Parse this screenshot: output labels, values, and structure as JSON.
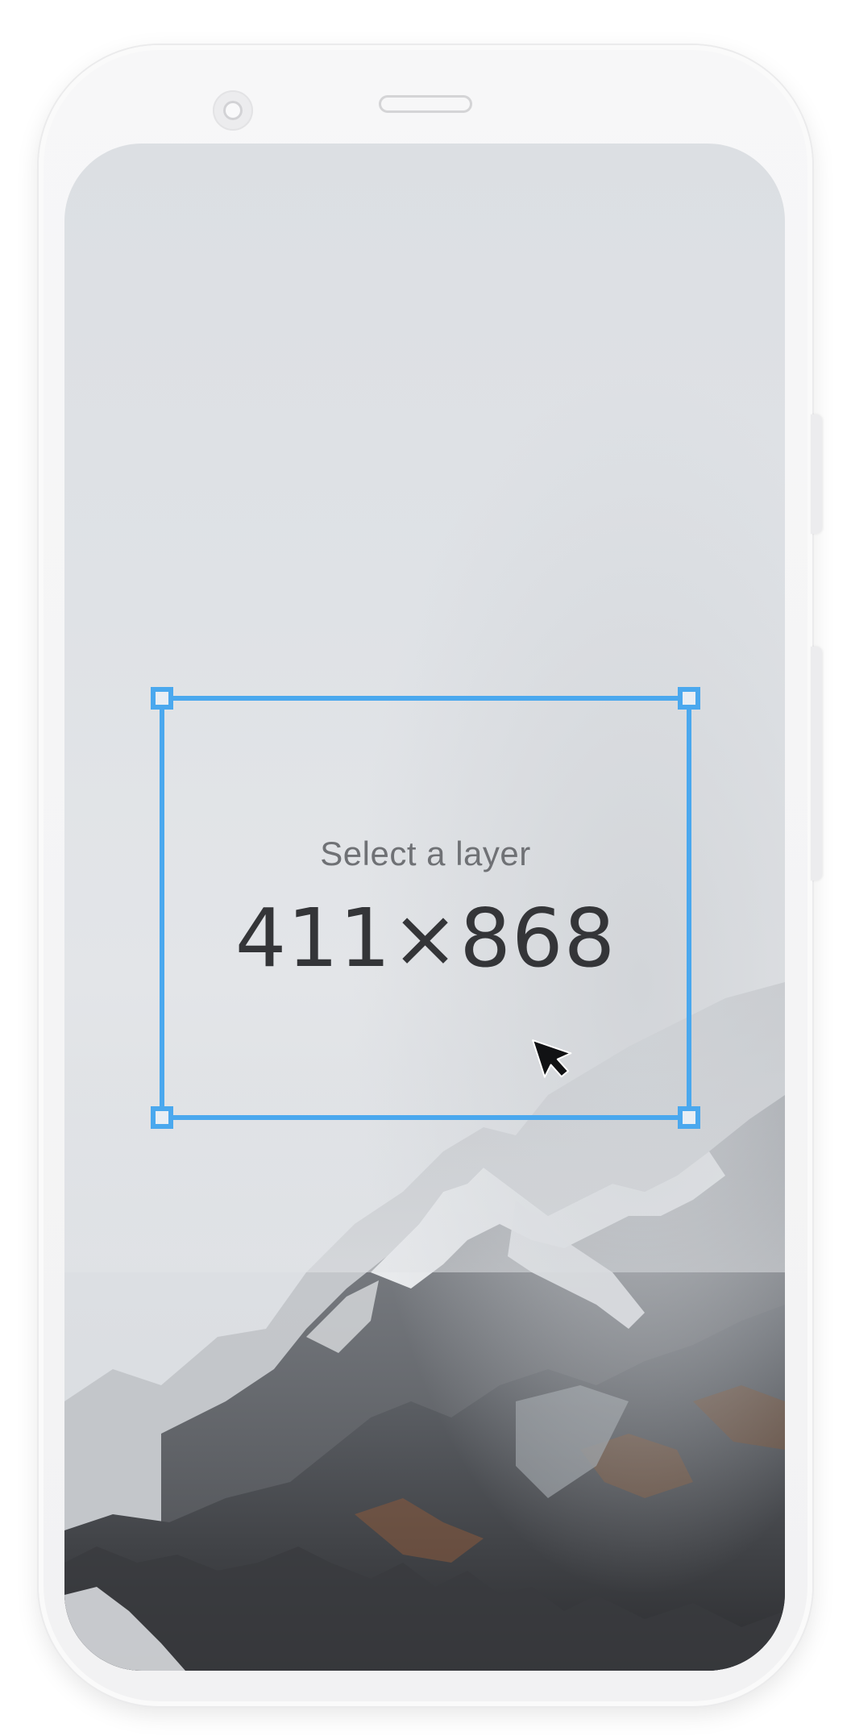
{
  "selection": {
    "hint": "Select a layer",
    "dimensions": "411×868"
  },
  "colors": {
    "selection_accent": "#4aa8ee",
    "screen_background": "#dfe2e6",
    "device_body": "#f4f4f5"
  },
  "icons": {
    "cursor": "arrow-cursor-icon",
    "camera": "front-camera-icon",
    "speaker": "speaker-grille-icon"
  }
}
